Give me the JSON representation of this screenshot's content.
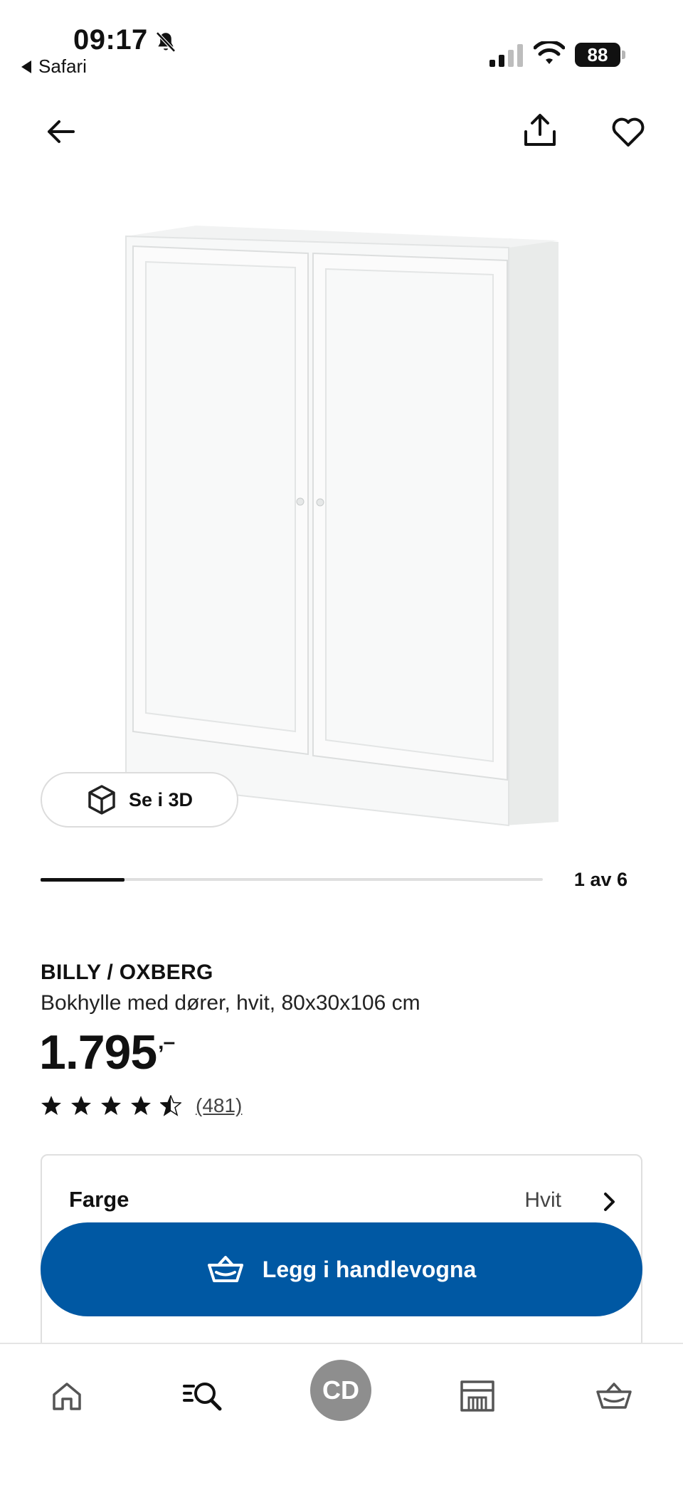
{
  "status_bar": {
    "time": "09:17",
    "back_app": "Safari",
    "battery_level": "88"
  },
  "top_nav": {
    "back_icon": "arrow-left-icon",
    "share_icon": "share-icon",
    "favorite_icon": "heart-icon"
  },
  "gallery": {
    "view_3d_label": "Se i 3D",
    "counter": "1 av 6",
    "current_index": 1,
    "total": 6
  },
  "product": {
    "name": "BILLY / OXBERG",
    "description": "Bokhylle med dører, hvit, 80x30x106 cm",
    "price_whole": "1.795",
    "price_cents": ",–",
    "rating_value": 4.5,
    "rating_max": 5,
    "review_count": "(481)"
  },
  "options": {
    "color_label": "Farge",
    "color_value": "Hvit"
  },
  "cta": {
    "add_to_cart_label": "Legg i handlevogna"
  },
  "bottom_nav": {
    "tabs": [
      "home-icon",
      "search-icon",
      "profile-avatar",
      "store-icon",
      "cart-icon"
    ],
    "avatar_initials": "CD"
  },
  "colors": {
    "accent": "#0058a3",
    "text": "#111111",
    "avatar": "#8e8e8e"
  }
}
